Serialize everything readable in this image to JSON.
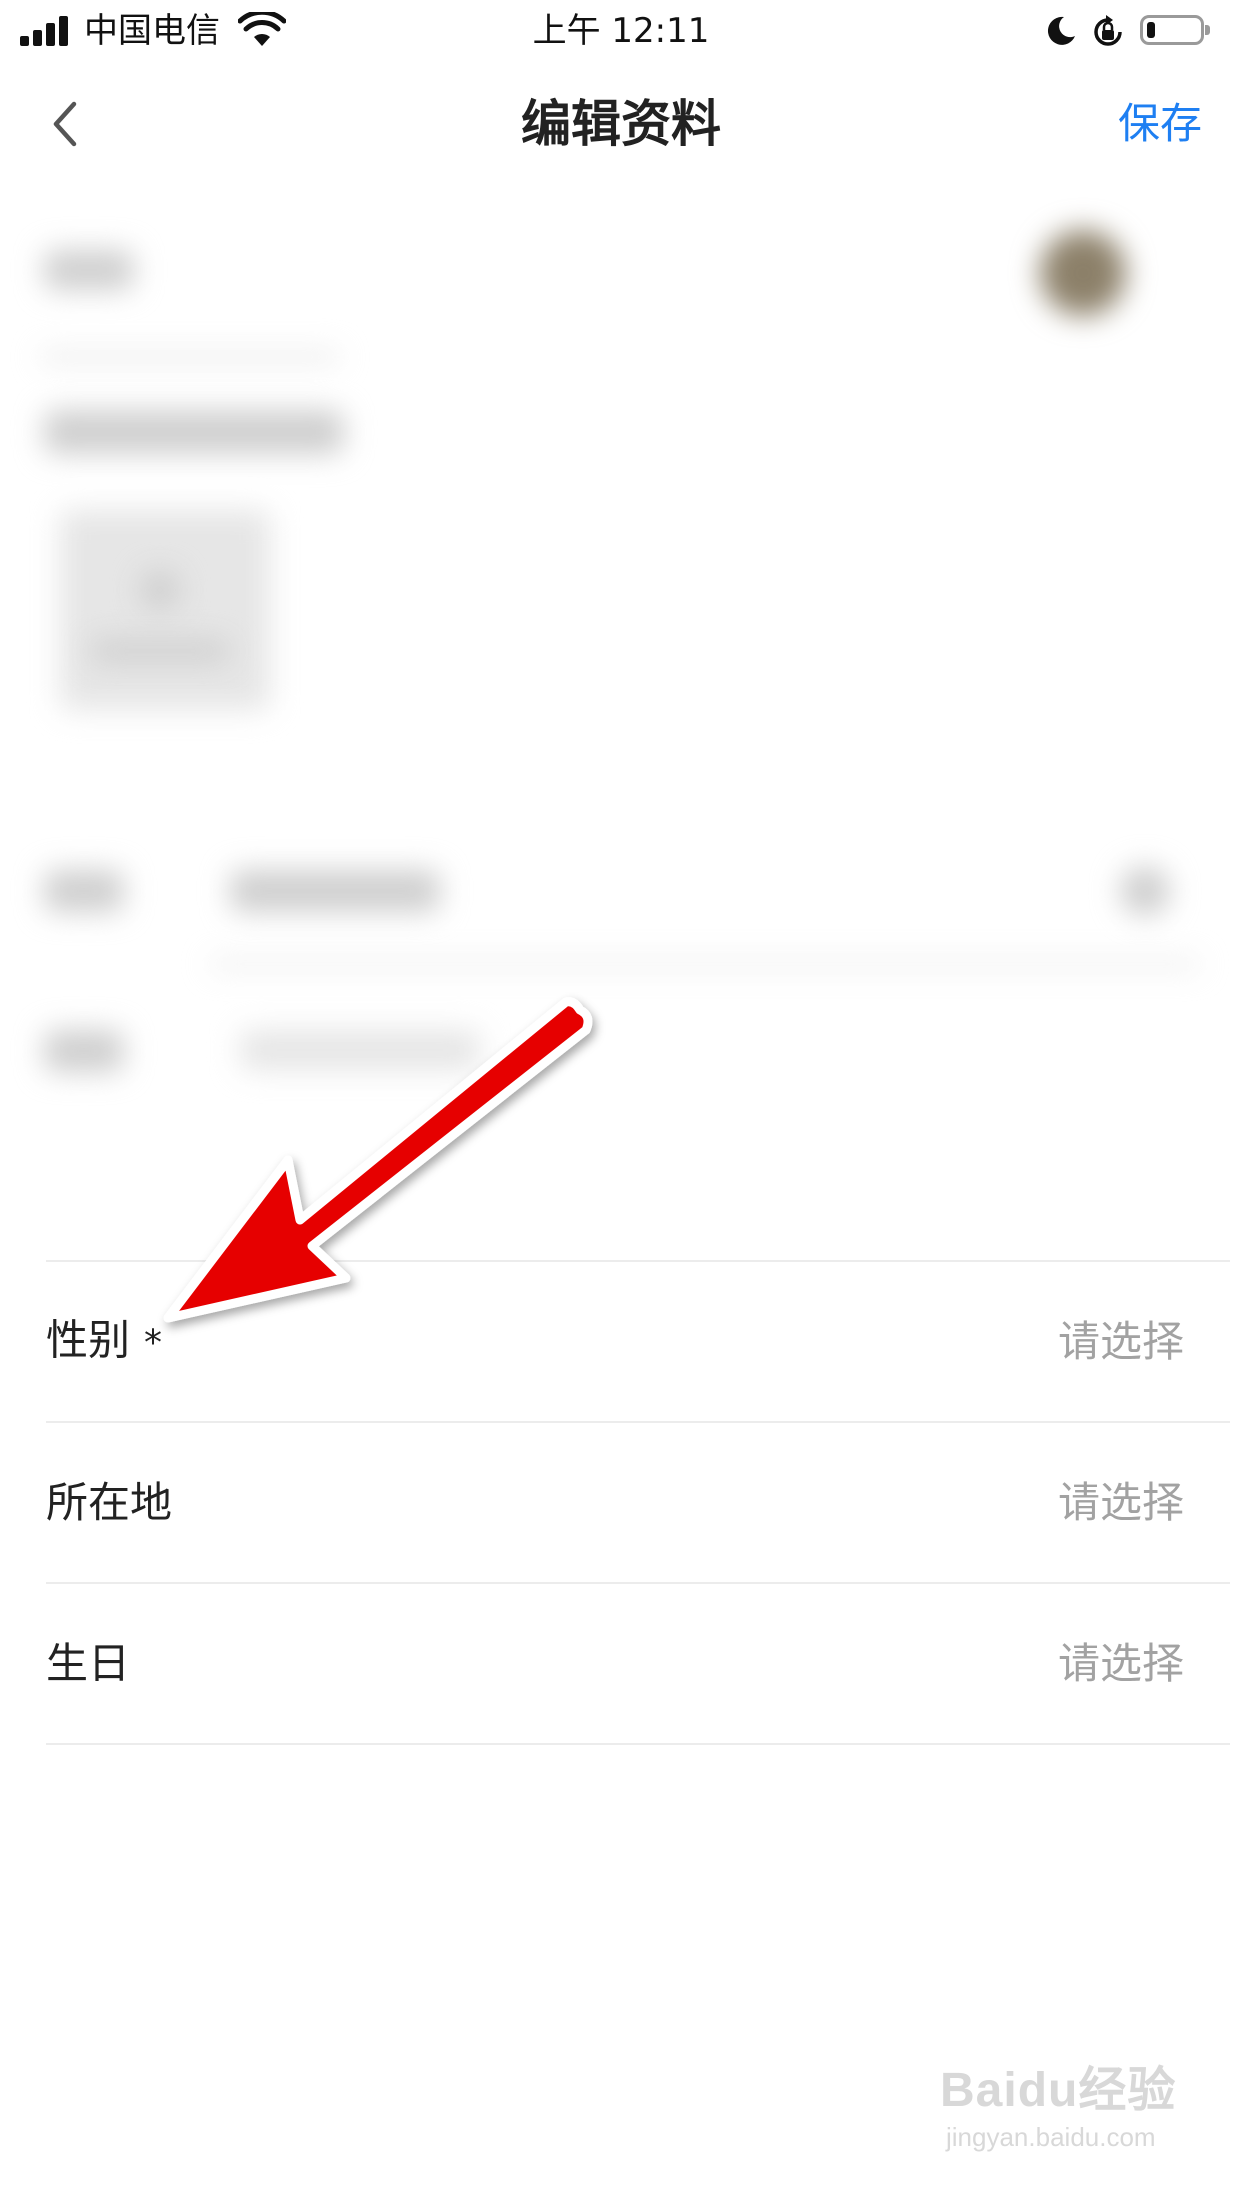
{
  "status_bar": {
    "carrier": "中国电信",
    "time": "上午 12:11",
    "battery_level": 0.15
  },
  "nav": {
    "title": "编辑资料",
    "save_label": "保存"
  },
  "form": {
    "rows": [
      {
        "label": "性别",
        "required_mark": "*",
        "value": "请选择"
      },
      {
        "label": "所在地",
        "required_mark": "",
        "value": "请选择"
      },
      {
        "label": "生日",
        "required_mark": "",
        "value": "请选择"
      }
    ]
  },
  "watermark": {
    "logo": "Baidu经验",
    "url": "jingyan.baidu.com"
  },
  "colors": {
    "accent": "#1e7ff2",
    "placeholder": "#a2a2a2",
    "annotation_arrow": "#e60000"
  }
}
